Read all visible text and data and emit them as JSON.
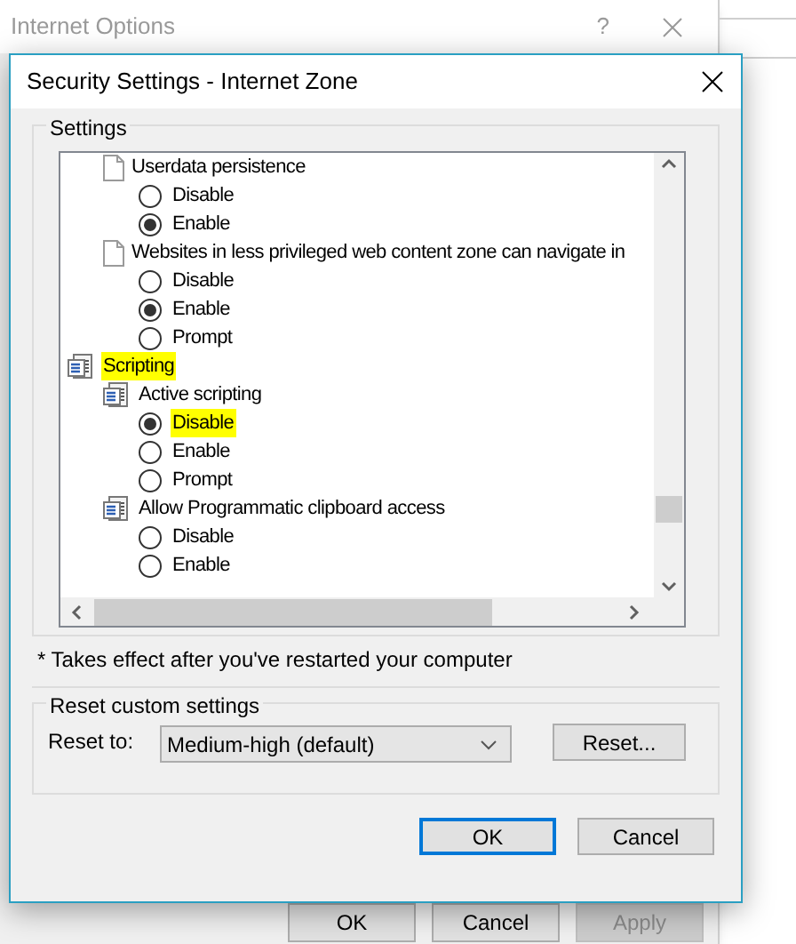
{
  "background_window": {
    "title": "Internet Options",
    "help": "?",
    "buttons": [
      {
        "label": "OK",
        "disabled": false
      },
      {
        "label": "Cancel",
        "disabled": false
      },
      {
        "label": "Apply",
        "disabled": true
      }
    ]
  },
  "dialog": {
    "title": "Security Settings - Internet Zone",
    "settings_group": {
      "label": "Settings",
      "tree": [
        {
          "kind": "document",
          "label": "Userdata persistence",
          "highlighted": false,
          "children": [
            {
              "kind": "radio",
              "label": "Disable",
              "selected": false,
              "highlighted": false
            },
            {
              "kind": "radio",
              "label": "Enable",
              "selected": true,
              "highlighted": false
            }
          ]
        },
        {
          "kind": "document",
          "label": "Websites in less privileged web content zone can navigate in",
          "highlighted": false,
          "children": [
            {
              "kind": "radio",
              "label": "Disable",
              "selected": false,
              "highlighted": false
            },
            {
              "kind": "radio",
              "label": "Enable",
              "selected": true,
              "highlighted": false
            },
            {
              "kind": "radio",
              "label": "Prompt",
              "selected": false,
              "highlighted": false
            }
          ]
        },
        {
          "kind": "category",
          "label": "Scripting",
          "highlighted": true,
          "children": [
            {
              "kind": "script",
              "label": "Active scripting",
              "highlighted": false,
              "children": [
                {
                  "kind": "radio",
                  "label": "Disable",
                  "selected": true,
                  "highlighted": true
                },
                {
                  "kind": "radio",
                  "label": "Enable",
                  "selected": false,
                  "highlighted": false
                },
                {
                  "kind": "radio",
                  "label": "Prompt",
                  "selected": false,
                  "highlighted": false
                }
              ]
            },
            {
              "kind": "script",
              "label": "Allow Programmatic clipboard access",
              "highlighted": false,
              "children": [
                {
                  "kind": "radio",
                  "label": "Disable",
                  "selected": false,
                  "highlighted": false
                },
                {
                  "kind": "radio",
                  "label": "Enable",
                  "selected": false,
                  "highlighted": false
                }
              ]
            }
          ]
        }
      ],
      "note": "* Takes effect after you've restarted your computer"
    },
    "reset_group": {
      "label": "Reset custom settings",
      "reset_to_label": "Reset to:",
      "dropdown_value": "Medium-high (default)",
      "reset_button": "Reset..."
    },
    "buttons": [
      {
        "label": "OK",
        "default": true
      },
      {
        "label": "Cancel",
        "default": false
      }
    ]
  }
}
